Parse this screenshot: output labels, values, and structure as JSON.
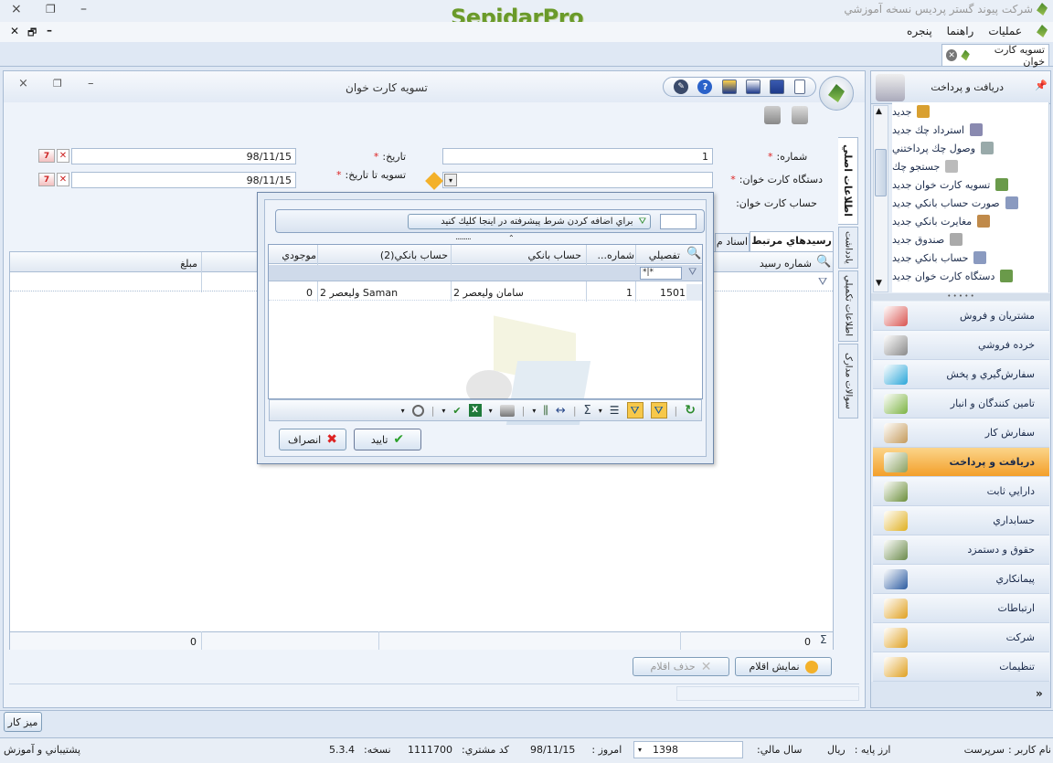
{
  "app": {
    "company_title": "شرکت پیوند گستر پردیس نسخه آموزشي",
    "logo_text": "SepidarPro",
    "window_close": "×",
    "window_restore": "❐",
    "window_minimize": "–"
  },
  "menu": {
    "operations": "عمليات",
    "help": "راهنما",
    "window": "پنجره",
    "mdi_close": "✕",
    "mdi_restore": "🗗",
    "mdi_minimize": "–"
  },
  "doc_tab": {
    "label": "تسويه کارت خوان"
  },
  "form": {
    "title": "تسويه کارت خوان",
    "number_label": "شماره:",
    "number_value": "1",
    "date_label": "تاريخ:",
    "date_value": "98/11/15",
    "device_label": "دستگاه کارت خوان:",
    "settle_to_date_label": "تسويه تا تاريخ:",
    "settle_to_date_value": "98/11/15",
    "account_label": "حساب کارت خوان:",
    "required": "*"
  },
  "side_tabs": {
    "main_info": "اطلاعات اصلي",
    "notes": "يادداشت",
    "extra_info": "اطلاعات تکميلي",
    "doc_questions": "سوالات مدارک"
  },
  "inner_tabs": {
    "related_receipts": "رسيدهاي مرتبط",
    "docs": "اسناد م"
  },
  "main_grid": {
    "col_receipt_no": "شماره رسيد",
    "col_amount": "مبلغ",
    "footer_count": "0",
    "footer_amount": "0"
  },
  "bottom_buttons": {
    "show_items": "نمايش اقلام",
    "delete_items": "حذف اقلام"
  },
  "popup": {
    "filter_hint": "براي اضافه كردن شرط پيشرفته در اينجا كليك كنيد",
    "dots": ".........",
    "columns": [
      "تفصيلي",
      "شماره...",
      "حساب بانكي",
      "حساب بانكي(2)",
      "موجودي"
    ],
    "filter_row_value": "*|*",
    "rows": [
      {
        "tafsili": "1501",
        "number": "1",
        "bank_account": "سامان وليعصر 2",
        "bank_account2": "Saman وليعصر 2",
        "balance": "0"
      }
    ],
    "ok_label": "تاييد",
    "cancel_label": "انصراف"
  },
  "sidebar": {
    "header_title": "دريافت و پرداخت",
    "items": [
      "جديد",
      "استرداد چك جديد",
      "وصول چك پرداختني",
      "جستجو چك",
      "تسويه كارت خوان جديد",
      "صورت حساب بانكي جديد",
      "مغايرت بانكي جديد",
      "صندوق جديد",
      "حساب بانكي جديد",
      "دستگاه كارت خوان جديد"
    ],
    "nav": [
      {
        "label": "مشتريان و فروش",
        "color": "#d9534f"
      },
      {
        "label": "خرده فروشي",
        "color": "#8a8a8a"
      },
      {
        "label": "سفارش‌گيري و پخش",
        "color": "#2aa6d9"
      },
      {
        "label": "تامين كنندگان و انبار",
        "color": "#7cb342"
      },
      {
        "label": "سفارش كار",
        "color": "#c49a5a"
      },
      {
        "label": "دريافت و پرداخت",
        "color": "#8aa060"
      },
      {
        "label": "دارايي ثابت",
        "color": "#6b8e3a"
      },
      {
        "label": "حسابداري",
        "color": "#e0b020"
      },
      {
        "label": "حقوق و دستمزد",
        "color": "#6a8a4a"
      },
      {
        "label": "پيمانكاري",
        "color": "#2a5aa0"
      },
      {
        "label": "ارتباطات",
        "color": "#e0a020"
      },
      {
        "label": "شركت",
        "color": "#e0a020"
      },
      {
        "label": "تنظيمات",
        "color": "#e0a020"
      }
    ],
    "active_nav_index": 5
  },
  "taskbar": {
    "desktop": "ميز كار"
  },
  "status": {
    "user_label": "نام كاربر :",
    "user_value": "سرپرست",
    "base_currency_label": "ارز پايه :",
    "base_currency_value": "ريال",
    "fiscal_year_label": "سال مالي:",
    "fiscal_year_value": "1398",
    "today_label": "امروز :",
    "today_value": "98/11/15",
    "customer_code_label": "كد مشتري:",
    "customer_code_value": "1111700",
    "version_label": "نسخه:",
    "version_value": "5.3.4",
    "support": "پشتيباني و آموزش"
  },
  "colors": {
    "accent_orange": "#f7b548",
    "logo_green": "#6a9a2a",
    "required_red": "#d22"
  }
}
